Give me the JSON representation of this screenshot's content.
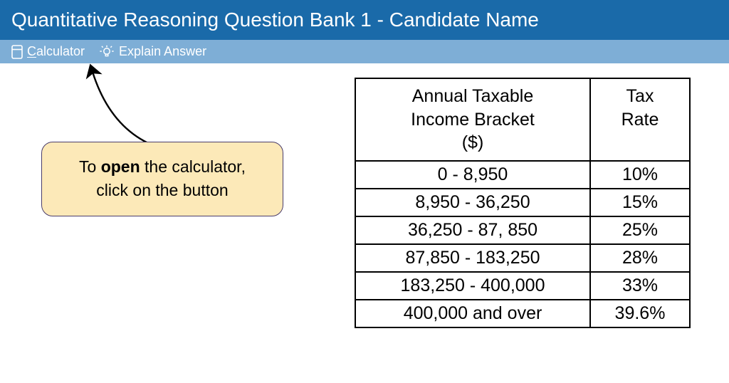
{
  "header": {
    "title": "Quantitative Reasoning Question Bank 1 - Candidate Name"
  },
  "toolbar": {
    "calculator_label": "Calculator",
    "explain_label": "Explain Answer"
  },
  "callout": {
    "line1_prefix": "To ",
    "line1_bold": "open",
    "line1_suffix": " the calculator,",
    "line2": "click on the button"
  },
  "table": {
    "header_col1": "Annual Taxable Income Bracket ($)",
    "header_col2": "Tax Rate",
    "rows": [
      {
        "bracket": "0 - 8,950",
        "rate": "10%"
      },
      {
        "bracket": "8,950 - 36,250",
        "rate": "15%"
      },
      {
        "bracket": "36,250 - 87, 850",
        "rate": "25%"
      },
      {
        "bracket": "87,850 - 183,250",
        "rate": "28%"
      },
      {
        "bracket": "183,250 - 400,000",
        "rate": "33%"
      },
      {
        "bracket": "400,000 and over",
        "rate": "39.6%"
      }
    ]
  }
}
